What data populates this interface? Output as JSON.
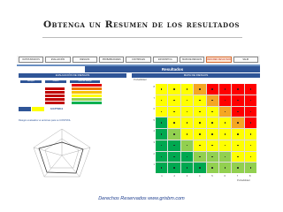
{
  "slide": {
    "title": "Obtenga un Resumen de los resultados",
    "footer": "Derechos Reservados www.grisbm.com"
  },
  "toolbar": {
    "tabs": [
      "DATOS BASICOS",
      "EVALUACIÓN",
      "RIESGOS",
      "PROBABILIDADES",
      "CONTROLES",
      "ESTADISTICA",
      "MAPA DE RIESGOS",
      "RESUMEN RESULTADOS",
      "SALIR"
    ],
    "active_index": 7
  },
  "header": {
    "title": "Resultados"
  },
  "left_panel": {
    "title": "EVALUACIÓN DE RIESGOS",
    "table_headers": [
      "Riesgos",
      "Valores",
      "Nivel de Riesgo"
    ],
    "values_color": "#c00000",
    "level_colors": [
      "#e10000",
      "#f07800",
      "#f7c000",
      "#ffff00",
      "#92d050",
      "#00b050"
    ],
    "status_chip": "ACEPTABLE",
    "chart_caption": "Riesgos evaluados vs acciones para su CONTROL"
  },
  "right_panel": {
    "title": "MAPA DE RIESGOS",
    "y_axis_label": "Probabilidad",
    "x_axis_label": "Probabilidad",
    "y_ticks": [
      "8",
      "7",
      "6",
      "5",
      "4",
      "3",
      "2",
      "1"
    ],
    "x_ticks": [
      "1",
      "2",
      "3",
      "4",
      "5",
      "6",
      "7",
      "8"
    ],
    "colors": {
      "red": "#ff0000",
      "orange": "#f5a623",
      "yellow": "#ffff00",
      "lightgreen": "#92d050",
      "green": "#00a850"
    },
    "grid": [
      [
        "yellow",
        "yellow",
        "yellow",
        "orange",
        "red",
        "red",
        "red",
        "red"
      ],
      [
        "yellow",
        "yellow",
        "yellow",
        "yellow",
        "orange",
        "red",
        "red",
        "red"
      ],
      [
        "yellow",
        "yellow",
        "yellow",
        "yellow",
        "yellow",
        "orange",
        "red",
        "red"
      ],
      [
        "green",
        "yellow",
        "yellow",
        "yellow",
        "yellow",
        "yellow",
        "orange",
        "red"
      ],
      [
        "green",
        "lightgreen",
        "yellow",
        "yellow",
        "yellow",
        "yellow",
        "yellow",
        "yellow"
      ],
      [
        "green",
        "green",
        "lightgreen",
        "yellow",
        "yellow",
        "yellow",
        "yellow",
        "yellow"
      ],
      [
        "green",
        "green",
        "green",
        "lightgreen",
        "lightgreen",
        "lightgreen",
        "yellow",
        "yellow"
      ],
      [
        "green",
        "green",
        "green",
        "green",
        "lightgreen",
        "lightgreen",
        "lightgreen",
        "lightgreen"
      ]
    ]
  }
}
